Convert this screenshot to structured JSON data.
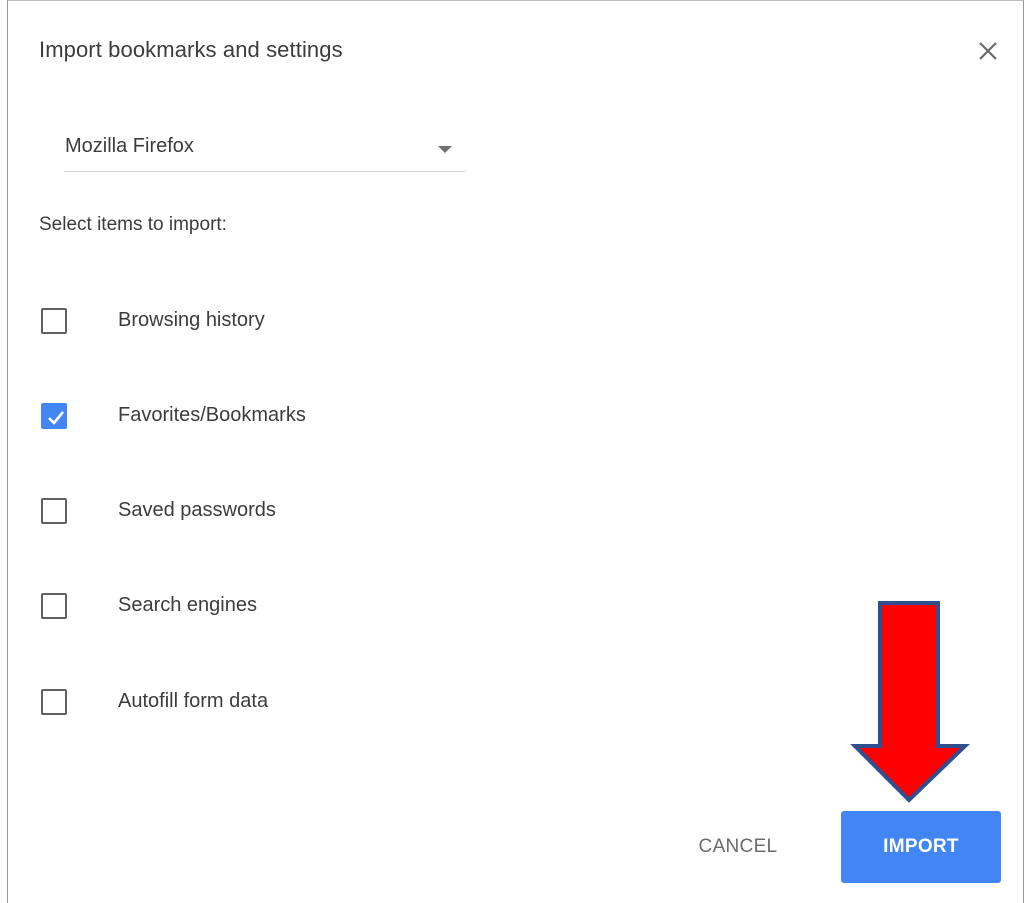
{
  "dialog": {
    "title": "Import bookmarks and settings",
    "close_icon": "close-icon"
  },
  "source_select": {
    "selected": "Mozilla Firefox",
    "arrow_icon": "dropdown-arrow-icon"
  },
  "section_label": "Select items to import:",
  "items": [
    {
      "label": "Browsing history",
      "checked": false
    },
    {
      "label": "Favorites/Bookmarks",
      "checked": true
    },
    {
      "label": "Saved passwords",
      "checked": false
    },
    {
      "label": "Search engines",
      "checked": false
    },
    {
      "label": "Autofill form data",
      "checked": false
    }
  ],
  "buttons": {
    "cancel": "CANCEL",
    "import": "IMPORT"
  },
  "annotation": {
    "icon": "red-down-arrow-icon",
    "fill_color": "#ff0000",
    "stroke_color": "#2f4f8f"
  },
  "colors": {
    "accent": "#4285f4",
    "text": "#3c3c3c"
  }
}
